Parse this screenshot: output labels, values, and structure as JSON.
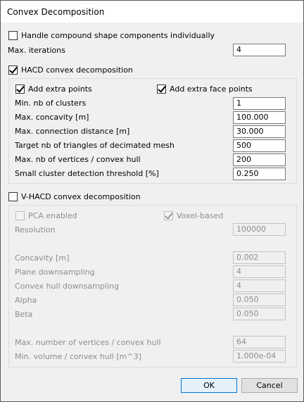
{
  "window": {
    "title": "Convex Decomposition"
  },
  "compound": {
    "label": "Handle compound shape components individually",
    "checked": false
  },
  "max_iterations": {
    "label": "Max. iterations",
    "value": "4"
  },
  "hacd": {
    "label": "HACD convex decomposition",
    "checked": true,
    "add_extra_points": {
      "label": "Add extra points",
      "checked": true
    },
    "add_extra_face_points": {
      "label": "Add extra face points",
      "checked": true
    },
    "fields": [
      {
        "label": "Min. nb of clusters",
        "value": "1"
      },
      {
        "label": "Max. concavity [m]",
        "value": "100.000"
      },
      {
        "label": "Max. connection distance [m]",
        "value": "30.000"
      },
      {
        "label": "Target nb of triangles of decimated mesh",
        "value": "500"
      },
      {
        "label": "Max. nb of vertices / convex hull",
        "value": "200"
      },
      {
        "label": "Small cluster detection threshold [%]",
        "value": "0.250"
      }
    ]
  },
  "vhacd": {
    "label": "V-HACD convex decomposition",
    "checked": false,
    "pca": {
      "label": "PCA enabled",
      "checked": false
    },
    "voxel": {
      "label": "Voxel-based",
      "checked": true
    },
    "resolution": {
      "label": "Resolution",
      "value": "100000"
    },
    "concavity": {
      "label": "Concavity [m]",
      "value": "0.002"
    },
    "plane_downsampling": {
      "label": "Plane downsampling",
      "value": "4"
    },
    "hull_downsampling": {
      "label": "Convex hull downsampling",
      "value": "4"
    },
    "alpha": {
      "label": "Alpha",
      "value": "0.050"
    },
    "beta": {
      "label": "Beta",
      "value": "0.050"
    },
    "max_vertices": {
      "label": "Max. number of vertices / convex hull",
      "value": "64"
    },
    "min_volume": {
      "label": "Min. volume / convex hull [m^3]",
      "value": "1.000e-04"
    }
  },
  "buttons": {
    "ok": "OK",
    "cancel": "Cancel"
  }
}
